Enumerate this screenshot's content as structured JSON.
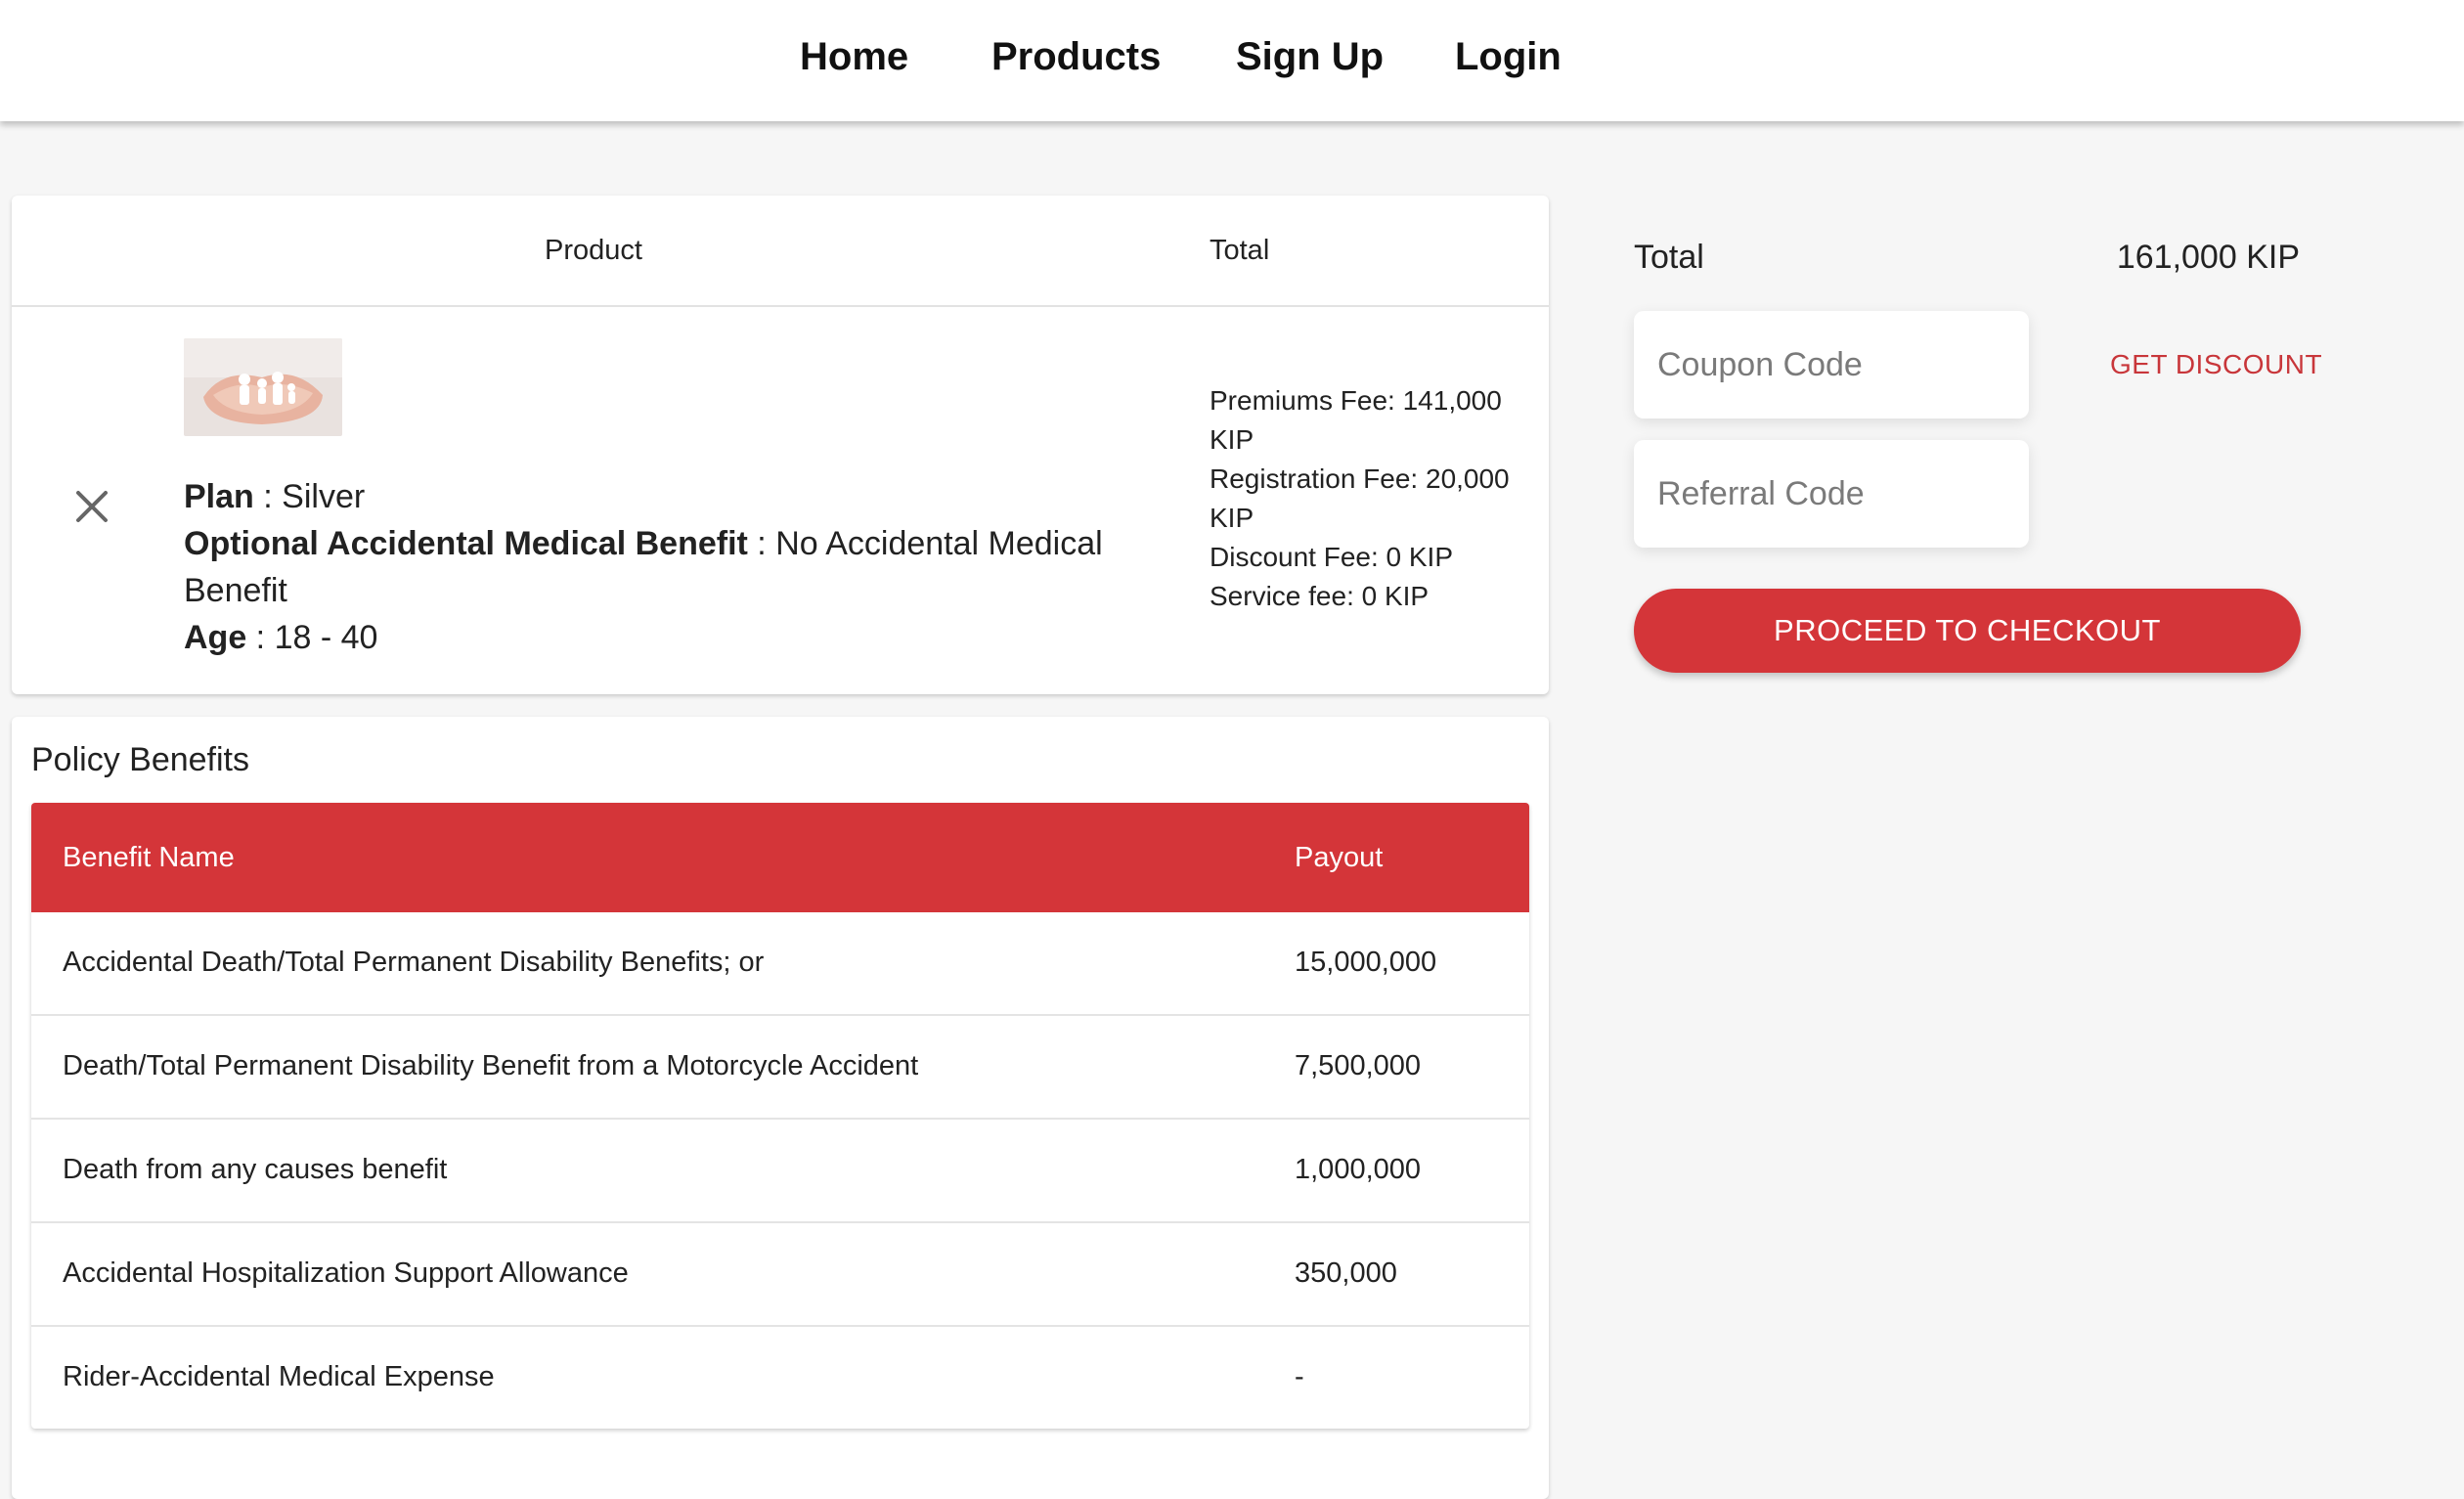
{
  "nav": {
    "home": "Home",
    "products": "Products",
    "signup": "Sign Up",
    "login": "Login"
  },
  "cart": {
    "header_product": "Product",
    "header_total": "Total",
    "item": {
      "plan_label": "Plan",
      "plan_value": "Silver",
      "optional_label": "Optional Accidental Medical Benefit",
      "optional_value": "No Accidental Medical Benefit",
      "age_label": "Age",
      "age_value": "18 - 40",
      "fees": [
        "Premiums Fee: 141,000 KIP",
        "Registration Fee: 20,000 KIP",
        "Discount Fee: 0 KIP",
        "Service fee: 0 KIP"
      ]
    }
  },
  "policy": {
    "title": "Policy Benefits",
    "col_name": "Benefit Name",
    "col_payout": "Payout",
    "rows": [
      {
        "name": "Accidental Death/Total Permanent Disability Benefits; or",
        "payout": "15,000,000"
      },
      {
        "name": "Death/Total Permanent Disability Benefit from a Motorcycle Accident",
        "payout": "7,500,000"
      },
      {
        "name": "Death from any causes benefit",
        "payout": "1,000,000"
      },
      {
        "name": "Accidental Hospitalization Support Allowance",
        "payout": "350,000"
      },
      {
        "name": "Rider-Accidental Medical Expense",
        "payout": "-"
      }
    ]
  },
  "summary": {
    "total_label": "Total",
    "total_value": "161,000 KIP",
    "coupon_placeholder": "Coupon Code",
    "referral_placeholder": "Referral Code",
    "get_discount": "GET DISCOUNT",
    "checkout": "PROCEED TO CHECKOUT"
  },
  "icons": {
    "remove": "close-icon",
    "thumbnail": "family-hands-image"
  },
  "colors": {
    "accent": "#d43539",
    "accent_text": "#c8363a"
  }
}
